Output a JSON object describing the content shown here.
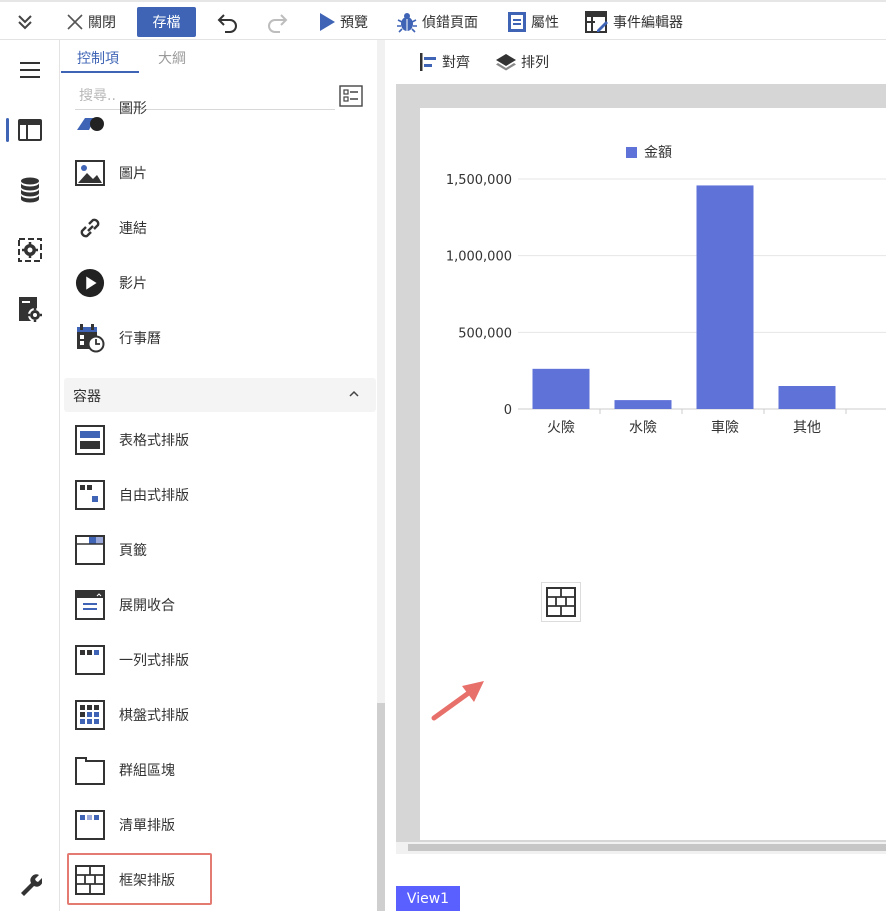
{
  "toolbar": {
    "close_label": "關閉",
    "save_label": "存檔",
    "preview_label": "預覽",
    "debug_label": "偵錯頁面",
    "properties_label": "屬性",
    "event_editor_label": "事件編輯器"
  },
  "panel": {
    "tabs": [
      "控制項",
      "大綱"
    ],
    "search_placeholder": "搜尋..",
    "items_top": [
      {
        "label": "圖形",
        "icon": "shape-icon"
      },
      {
        "label": "圖片",
        "icon": "image-icon"
      },
      {
        "label": "連結",
        "icon": "link-icon"
      },
      {
        "label": "影片",
        "icon": "video-icon"
      },
      {
        "label": "行事曆",
        "icon": "calendar-icon"
      }
    ],
    "section_label": "容器",
    "container_items": [
      {
        "label": "表格式排版",
        "icon": "table-layout-icon"
      },
      {
        "label": "自由式排版",
        "icon": "free-layout-icon"
      },
      {
        "label": "頁籤",
        "icon": "tabs-icon"
      },
      {
        "label": "展開收合",
        "icon": "collapse-icon"
      },
      {
        "label": "一列式排版",
        "icon": "row-layout-icon"
      },
      {
        "label": "棋盤式排版",
        "icon": "grid-layout-icon"
      },
      {
        "label": "群組區塊",
        "icon": "group-block-icon"
      },
      {
        "label": "清單排版",
        "icon": "list-layout-icon"
      },
      {
        "label": "框架排版",
        "icon": "frame-layout-icon"
      }
    ]
  },
  "canvas": {
    "align_label": "對齊",
    "arrange_label": "排列",
    "view_tab": "View1"
  },
  "colors": {
    "accent": "#3f64b5",
    "bar": "#5f72d8",
    "highlight": "#e37b72",
    "arrow": "#e8706a",
    "view_tab": "#5a5fff"
  },
  "chart_data": {
    "type": "bar",
    "categories": [
      "火險",
      "水險",
      "車險",
      "其他"
    ],
    "series": [
      {
        "name": "金額",
        "values": [
          262000,
          58000,
          1458000,
          150000
        ]
      }
    ],
    "ylim": [
      0,
      1500000
    ],
    "yticks": [
      "1,500,000",
      "1,000,000",
      "500,000",
      "0"
    ],
    "legend": "top",
    "grid": true
  }
}
